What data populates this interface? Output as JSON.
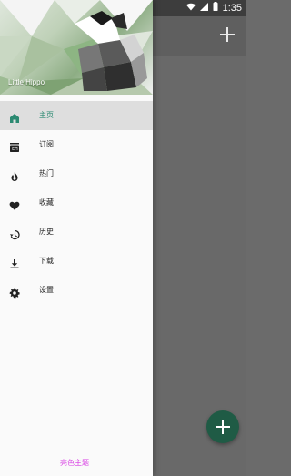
{
  "status": {
    "time": "1:35"
  },
  "drawer": {
    "username": "Little Hippo",
    "items": [
      {
        "label": "主页",
        "icon": "home-icon",
        "active": true
      },
      {
        "label": "订阅",
        "icon": "subscriptions-icon",
        "active": false
      },
      {
        "label": "热门",
        "icon": "fire-icon",
        "active": false
      },
      {
        "label": "收藏",
        "icon": "heart-icon",
        "active": false
      },
      {
        "label": "历史",
        "icon": "history-icon",
        "active": false
      },
      {
        "label": "下载",
        "icon": "download-icon",
        "active": false
      },
      {
        "label": "设置",
        "icon": "settings-icon",
        "active": false
      }
    ],
    "theme_link": "亮色主题"
  },
  "colors": {
    "accent": "#2c8a72",
    "fab": "#1f5b45",
    "theme_link": "#d83de4"
  }
}
